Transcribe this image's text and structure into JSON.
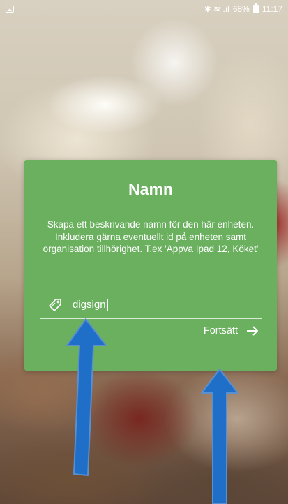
{
  "status_bar": {
    "left_icon": "image-notification-icon",
    "signal_icons": "✱ ≋ .ıl",
    "battery_percent": "68%",
    "time": "11:17"
  },
  "dialog": {
    "title": "Namn",
    "description": "Skapa ett beskrivande namn för den här enheten. Inkludera gärna eventuellt id på enheten samt organisation tillhörighet. T.ex 'Appva Ipad 12, Köket'",
    "input": {
      "icon": "tag-icon",
      "value": "digsign"
    },
    "continue_label": "Fortsätt",
    "continue_icon": "arrow-right-icon"
  },
  "colors": {
    "dialog_bg": "#6ab05f",
    "annotation_arrow": "#1f6fc9"
  }
}
